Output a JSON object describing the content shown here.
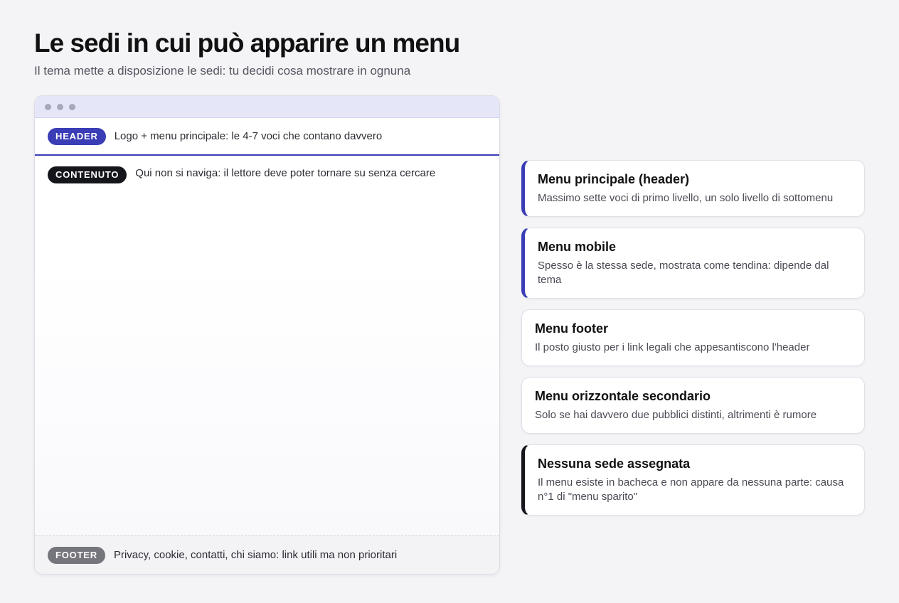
{
  "page": {
    "title": "Le sedi in cui può apparire un menu",
    "subtitle": "Il tema mette a disposizione le sedi: tu decidi cosa mostrare in ognuna"
  },
  "mockup": {
    "header": {
      "badge": "HEADER",
      "text": "Logo + menu principale: le 4-7 voci che contano davvero"
    },
    "content": {
      "badge": "CONTENUTO",
      "text": "Qui non si naviga: il lettore deve poter tornare su senza cercare"
    },
    "footer": {
      "badge": "FOOTER",
      "text": "Privacy, cookie, contatti, chi siamo: link utili ma non prioritari"
    }
  },
  "cards": [
    {
      "title": "Menu principale (header)",
      "desc": "Massimo sette voci di primo livello, un solo livello di sottomenu",
      "accent": "#3a3db5"
    },
    {
      "title": "Menu mobile",
      "desc": "Spesso è la stessa sede, mostrata come tendina: dipende dal tema",
      "accent": "#3a3db5"
    },
    {
      "title": "Menu footer",
      "desc": "Il posto giusto per i link legali che appesantiscono l'header",
      "accent": "none"
    },
    {
      "title": "Menu orizzontale secondario",
      "desc": "Solo se hai davvero due pubblici distinti, altrimenti è rumore",
      "accent": "none"
    },
    {
      "title": "Nessuna sede assegnata",
      "desc": "Il menu esiste in bacheca e non appare da nessuna parte: causa n°1 di \"menu sparito\"",
      "accent": "#15151c"
    }
  ],
  "colors": {
    "header_badge": "#3a3db5",
    "content_badge": "#15151c",
    "footer_badge": "#75757c",
    "titlebar": "#e5e6f8"
  }
}
